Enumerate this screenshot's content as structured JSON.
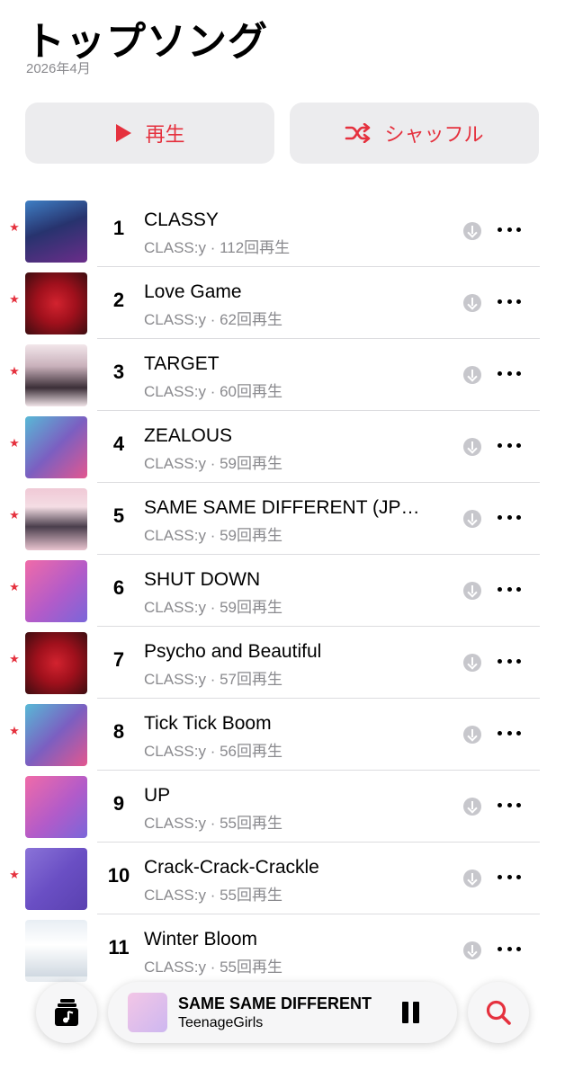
{
  "header": {
    "title": "トップソング",
    "subtitle": "2026年4月"
  },
  "actions": {
    "play_label": "再生",
    "shuffle_label": "シャッフル",
    "accent_color": "#e5313e"
  },
  "tracks": [
    {
      "rank": "1",
      "title": "CLASSY",
      "meta": "CLASS:y · 112回再生",
      "starred": true
    },
    {
      "rank": "2",
      "title": "Love Game",
      "meta": "CLASS:y · 62回再生",
      "starred": true
    },
    {
      "rank": "3",
      "title": "TARGET",
      "meta": "CLASS:y · 60回再生",
      "starred": true
    },
    {
      "rank": "4",
      "title": "ZEALOUS",
      "meta": "CLASS:y · 59回再生",
      "starred": true
    },
    {
      "rank": "5",
      "title": "SAME SAME DIFFERENT (JP…",
      "meta": "CLASS:y · 59回再生",
      "starred": true
    },
    {
      "rank": "6",
      "title": "SHUT DOWN",
      "meta": "CLASS:y · 59回再生",
      "starred": true
    },
    {
      "rank": "7",
      "title": "Psycho and Beautiful",
      "meta": "CLASS:y · 57回再生",
      "starred": true
    },
    {
      "rank": "8",
      "title": "Tick Tick Boom",
      "meta": "CLASS:y · 56回再生",
      "starred": true
    },
    {
      "rank": "9",
      "title": "UP",
      "meta": "CLASS:y · 55回再生",
      "starred": false
    },
    {
      "rank": "10",
      "title": "Crack-Crack-Crackle",
      "meta": "CLASS:y · 55回再生",
      "starred": true
    },
    {
      "rank": "11",
      "title": "Winter Bloom",
      "meta": "CLASS:y · 55回再生",
      "starred": false
    }
  ],
  "now_playing": {
    "title": "SAME SAME DIFFERENT",
    "artist": "TeenageGirls"
  },
  "icons": {
    "play": "play-icon",
    "shuffle": "shuffle-icon",
    "star": "star-icon",
    "download": "download-icon",
    "more": "more-icon",
    "library": "library-icon",
    "pause": "pause-icon",
    "search": "search-icon"
  }
}
